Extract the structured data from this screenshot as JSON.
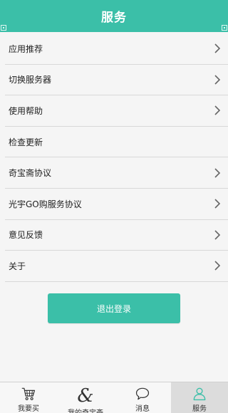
{
  "header": {
    "title": "服务"
  },
  "menu": {
    "items": [
      {
        "label": "应用推荐",
        "has_arrow": true
      },
      {
        "label": "切换服务器",
        "has_arrow": true
      },
      {
        "label": "使用帮助",
        "has_arrow": true
      },
      {
        "label": "检查更新",
        "has_arrow": false
      },
      {
        "label": "奇宝斋协议",
        "has_arrow": true
      },
      {
        "label": "光宇GO购服务协议",
        "has_arrow": true
      },
      {
        "label": "意见反馈",
        "has_arrow": true
      },
      {
        "label": "关于",
        "has_arrow": true
      }
    ]
  },
  "logout": {
    "label": "退出登录"
  },
  "tabbar": {
    "tabs": [
      {
        "label": "我要买",
        "icon": "cart-icon"
      },
      {
        "label": "我的奇宝斋",
        "icon": "ampersand-icon"
      },
      {
        "label": "消息",
        "icon": "chat-bubble-icon"
      },
      {
        "label": "服务",
        "icon": "person-icon",
        "active": true
      }
    ]
  },
  "colors": {
    "accent": "#3bbfa8",
    "background": "#f5f5f5",
    "divider": "#d8d8d8"
  }
}
